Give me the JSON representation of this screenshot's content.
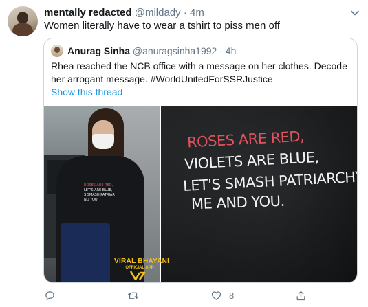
{
  "tweet": {
    "author_name": "mentally redacted",
    "author_handle": "@mildady",
    "separator": "·",
    "time": "4m",
    "text": "Women literally have to wear a tshirt to piss men off"
  },
  "quoted_tweet": {
    "author_name": "Anurag Sinha",
    "author_handle": "@anuragsinha1992",
    "separator": "·",
    "time": "4h",
    "text": "Rhea reached the NCB office with a message on her clothes. Decode her arrogant message. #WorldUnitedForSSRJustice",
    "show_thread_label": "Show this thread"
  },
  "media": {
    "left_photo_shirt_lines": [
      "ROSES ARE RED,",
      "LET'S ARE BLUE,",
      "S SMASH PATRIAR",
      "ND YOU."
    ],
    "shirt_lines": [
      "ROSES ARE RED,",
      "VIOLETS ARE BLUE,",
      "LET'S SMASH PATRIARCHY,",
      "ME AND YOU."
    ],
    "watermark_title": "VIRAL BHAYANI",
    "watermark_subtitle": "OFFICIAL APP"
  },
  "actions": {
    "reply_icon": "reply-icon",
    "retweet_icon": "retweet-icon",
    "like_icon": "heart-icon",
    "share_icon": "share-icon",
    "like_count": "8"
  },
  "colors": {
    "link": "#1b95e0",
    "secondary_text": "#657786",
    "border": "#ccd6dd",
    "shirt_red": "#e0525c",
    "watermark": "#f3c21b"
  }
}
